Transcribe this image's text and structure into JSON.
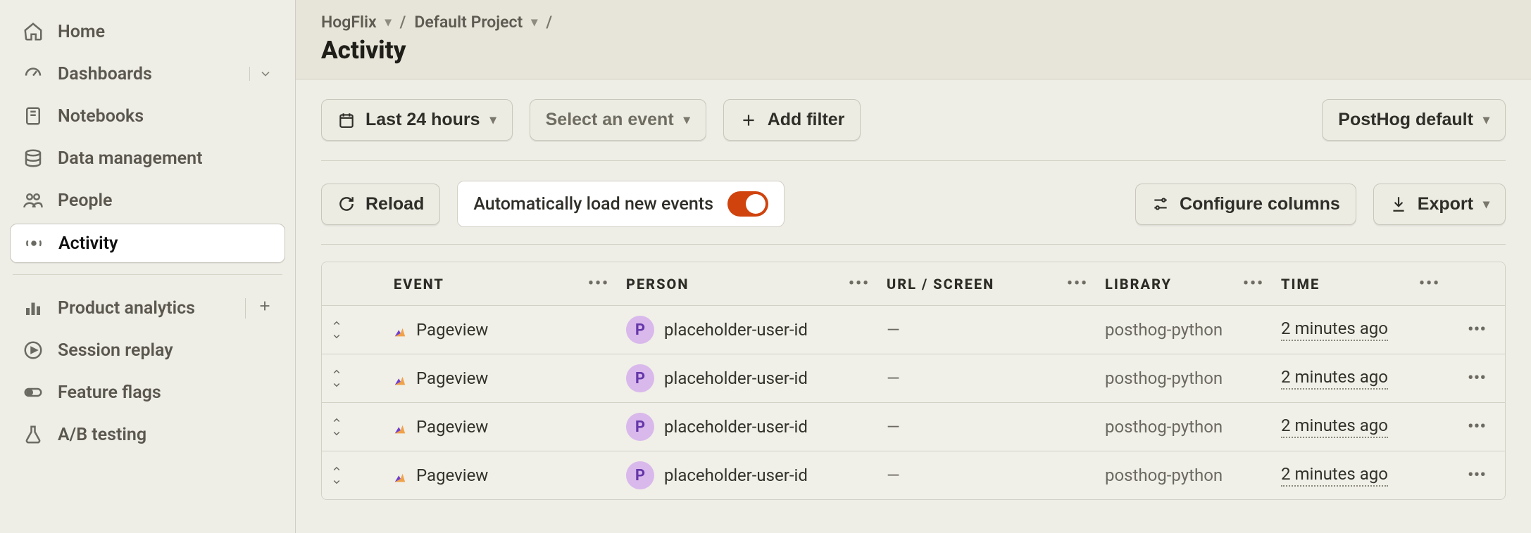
{
  "sidebar": {
    "items": [
      {
        "label": "Home"
      },
      {
        "label": "Dashboards"
      },
      {
        "label": "Notebooks"
      },
      {
        "label": "Data management"
      },
      {
        "label": "People"
      },
      {
        "label": "Activity"
      },
      {
        "label": "Product analytics"
      },
      {
        "label": "Session replay"
      },
      {
        "label": "Feature flags"
      },
      {
        "label": "A/B testing"
      }
    ]
  },
  "breadcrumb": {
    "org": "HogFlix",
    "project": "Default Project"
  },
  "page": {
    "title": "Activity"
  },
  "filters": {
    "time_range": "Last 24 hours",
    "event_select": "Select an event",
    "add_filter": "Add filter",
    "columns_preset": "PostHog default"
  },
  "controls": {
    "reload": "Reload",
    "autoload_label": "Automatically load new events",
    "autoload_on": true,
    "configure_columns": "Configure columns",
    "export": "Export"
  },
  "table": {
    "columns": [
      "EVENT",
      "PERSON",
      "URL / SCREEN",
      "LIBRARY",
      "TIME"
    ],
    "rows": [
      {
        "event": "Pageview",
        "person": "placeholder-user-id",
        "person_initial": "P",
        "url": "—",
        "library": "posthog-python",
        "time": "2 minutes ago"
      },
      {
        "event": "Pageview",
        "person": "placeholder-user-id",
        "person_initial": "P",
        "url": "—",
        "library": "posthog-python",
        "time": "2 minutes ago"
      },
      {
        "event": "Pageview",
        "person": "placeholder-user-id",
        "person_initial": "P",
        "url": "—",
        "library": "posthog-python",
        "time": "2 minutes ago"
      },
      {
        "event": "Pageview",
        "person": "placeholder-user-id",
        "person_initial": "P",
        "url": "—",
        "library": "posthog-python",
        "time": "2 minutes ago"
      }
    ]
  }
}
